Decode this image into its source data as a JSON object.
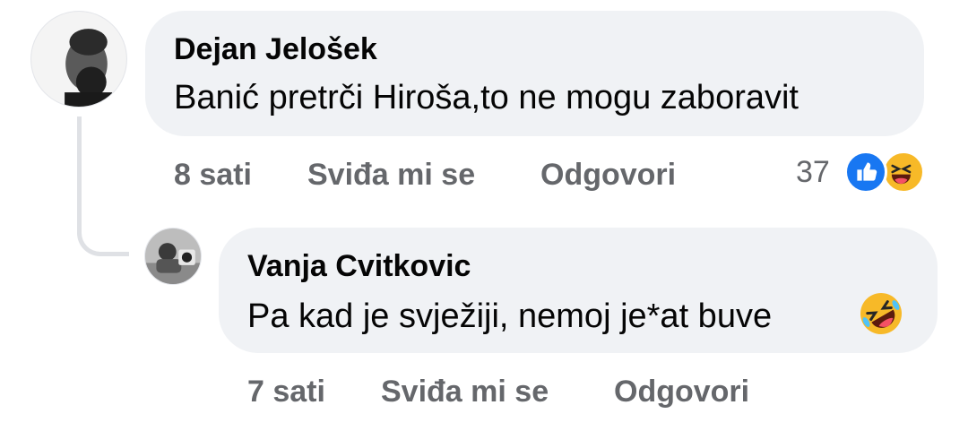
{
  "comments": [
    {
      "author": "Dejan Jelošek",
      "text": "Banić pretrči Hiroša,to ne mogu zaboravit",
      "time": "8 sati",
      "like_label": "Sviđa mi se",
      "reply_label": "Odgovori",
      "reaction_count": "37",
      "reactions": [
        "like-icon",
        "laughing-emoji-icon"
      ]
    },
    {
      "author": "Vanja Cvitkovic",
      "text": "Pa kad je svježiji, nemoj je*at buve",
      "emoji": "rolling-on-floor-laughing-emoji-icon",
      "time": "7 sati",
      "like_label": "Sviđa mi se",
      "reply_label": "Odgovori"
    }
  ],
  "colors": {
    "bubble": "#f0f2f5",
    "meta_text": "#65676b",
    "like_blue": "#1877f2",
    "emoji_yellow": "#f7b928"
  }
}
